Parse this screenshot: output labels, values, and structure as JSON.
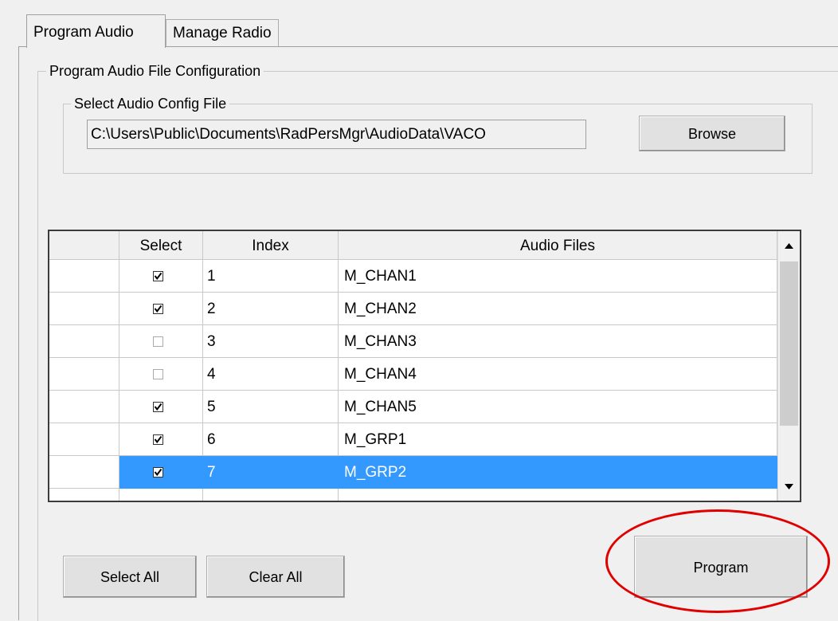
{
  "tabs": [
    {
      "label": "Program Audio",
      "active": true
    },
    {
      "label": "Manage Radio",
      "active": false
    }
  ],
  "program_group": {
    "legend": "Program Audio File Configuration",
    "config_file": {
      "legend": "Select Audio Config File",
      "path": "C:\\Users\\Public\\Documents\\RadPersMgr\\AudioData\\VACO",
      "browse_label": "Browse"
    }
  },
  "grid": {
    "columns": [
      "",
      "Select",
      "Index",
      "Audio Files"
    ],
    "rows": [
      {
        "checked": true,
        "index": "1",
        "file": "M_CHAN1",
        "selected": false
      },
      {
        "checked": true,
        "index": "2",
        "file": "M_CHAN2",
        "selected": false
      },
      {
        "checked": false,
        "index": "3",
        "file": "M_CHAN3",
        "selected": false
      },
      {
        "checked": false,
        "index": "4",
        "file": "M_CHAN4",
        "selected": false
      },
      {
        "checked": true,
        "index": "5",
        "file": "M_CHAN5",
        "selected": false
      },
      {
        "checked": true,
        "index": "6",
        "file": "M_GRP1",
        "selected": false
      },
      {
        "checked": true,
        "index": "7",
        "file": "M_GRP2",
        "selected": true
      }
    ]
  },
  "buttons": {
    "select_all": "Select All",
    "clear_all": "Clear All",
    "program": "Program"
  },
  "colors": {
    "selection": "#3399ff",
    "highlight_circle": "#e00000"
  }
}
